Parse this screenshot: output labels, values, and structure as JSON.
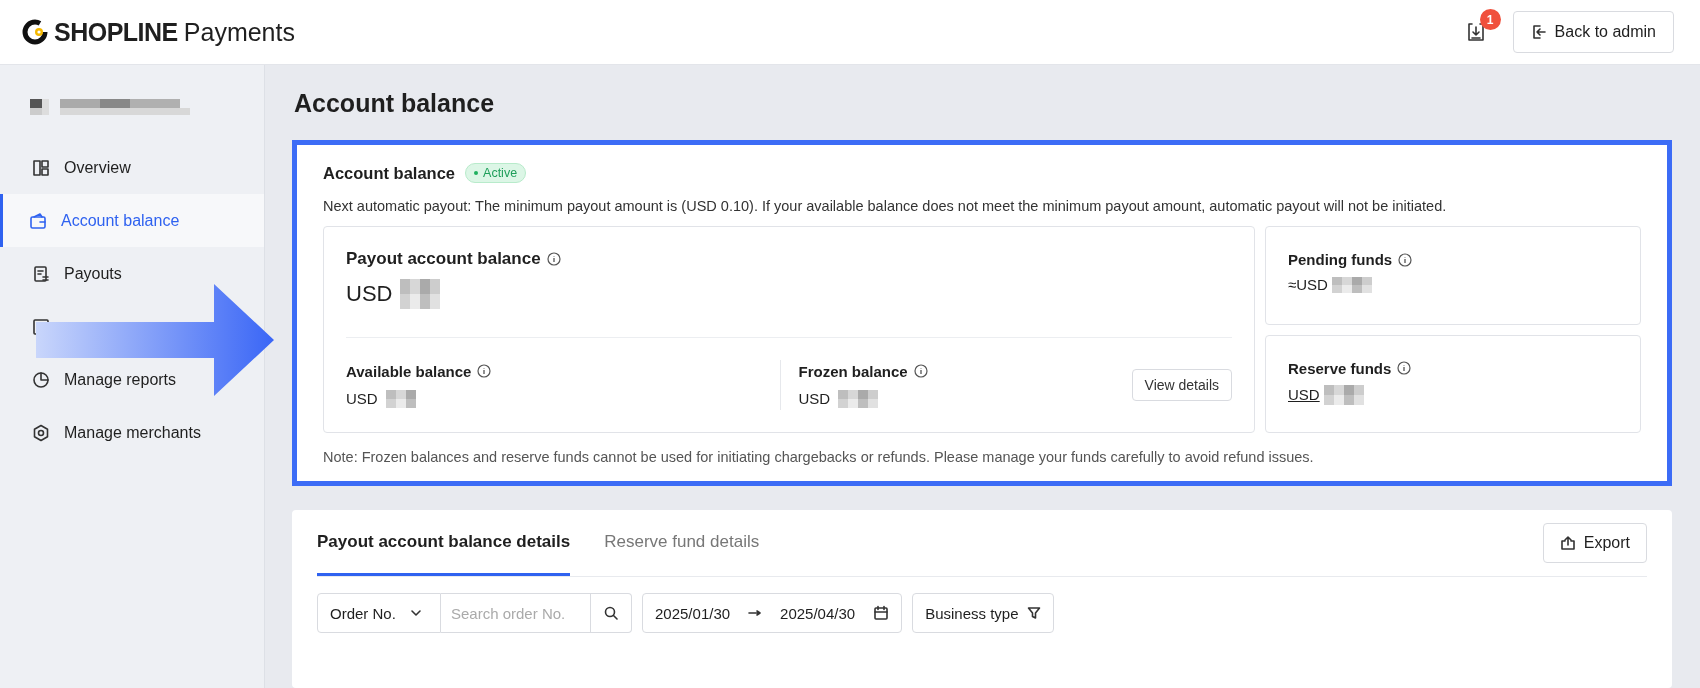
{
  "header": {
    "brand": "SHOPLINE",
    "product": "Payments",
    "notification_count": "1",
    "back_button": "Back to admin"
  },
  "sidebar": {
    "items": [
      {
        "label": "Overview",
        "selected": false
      },
      {
        "label": "Account balance",
        "selected": true
      },
      {
        "label": "Payouts",
        "selected": false
      },
      {
        "selected": false
      },
      {
        "label": "Manage reports",
        "selected": false
      },
      {
        "label": "Manage merchants",
        "selected": false
      }
    ]
  },
  "page_title": "Account balance",
  "balance_card": {
    "title": "Account balance",
    "status": "Active",
    "payout_note": "Next automatic payout: The minimum payout amount is (USD 0.10). If your available balance does not meet the minimum payout amount, automatic payout will not be initiated.",
    "payout_balance": {
      "label": "Payout account balance",
      "currency": "USD"
    },
    "available": {
      "label": "Available balance",
      "currency": "USD"
    },
    "frozen": {
      "label": "Frozen balance",
      "currency": "USD",
      "button": "View details"
    },
    "pending": {
      "label": "Pending funds",
      "currency": "≈USD"
    },
    "reserve": {
      "label": "Reserve funds",
      "currency": "USD"
    },
    "footnote": "Note: Frozen balances and reserve funds cannot be used for initiating chargebacks or refunds. Please manage your funds carefully to avoid refund issues."
  },
  "details": {
    "tabs": [
      {
        "label": "Payout account balance details",
        "selected": true
      },
      {
        "label": "Reserve fund details",
        "selected": false
      }
    ],
    "export_button": "Export",
    "filters": {
      "search_type": "Order No.",
      "search_placeholder": "Search order No.",
      "date_start": "2025/01/30",
      "date_end": "2025/04/30",
      "business_type": "Business type"
    }
  }
}
